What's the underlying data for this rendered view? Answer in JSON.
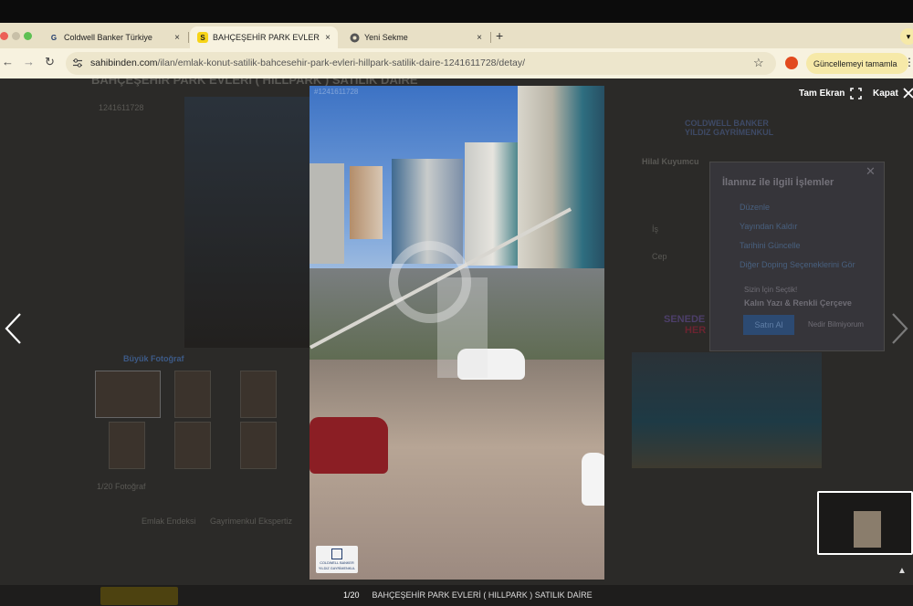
{
  "browser": {
    "tabs": [
      {
        "title": "Coldwell Banker Türkiye",
        "favicon": "cb-favicon-icon",
        "active": false
      },
      {
        "title": "BAHÇEŞEHİR PARK EVLERİ ( H",
        "favicon": "sahibinden-favicon-icon",
        "active": true
      },
      {
        "title": "Yeni Sekme",
        "favicon": "chrome-favicon-icon",
        "active": false
      }
    ],
    "url_domain": "sahibinden.com",
    "url_path": "/ilan/emlak-konut-satilik-bahcesehir-park-evleri-hillpark-satilik-daire-1241611728/detay/",
    "update_button": "Güncellemeyi tamamla",
    "new_tab_symbol": "+",
    "tab_close_symbol": "×"
  },
  "background_page": {
    "listing_title": "BAHÇEŞEHİR PARK EVLERİ ( HILLPARK ) SATILIK DAİRE",
    "listing_no": "1241611728",
    "big_photo_link": "Büyük Fotoğraf",
    "photo_count": "1/20 Fotoğraf",
    "links": [
      "Emlak Endeksi",
      "Gayrimenkul Ekspertiz"
    ],
    "agency": "COLDWELL BANKER YILDIZ GAYRİMENKUL",
    "seller": "Hilal Kuyumcu",
    "labels": [
      "İş",
      "Cep"
    ],
    "panel": {
      "title": "İlanınız ile ilgili İşlemler",
      "items": [
        "Düzenle",
        "Yayından Kaldır",
        "Tarihini Güncelle",
        "Diğer Doping Seçeneklerini Gör"
      ],
      "promo_label": "Sizin İçin Seçtik!",
      "promo_text": "Kalın Yazı & Renkli Çerçeve",
      "buy_button": "Satın Al",
      "info_link": "Nedir Bilmiyorum"
    },
    "banner": [
      "SENEDE",
      "HER"
    ]
  },
  "viewer": {
    "watermark_id": "#1241611728",
    "fullscreen_label": "Tam Ekran",
    "close_label": "Kapat",
    "counter": "1/20",
    "caption": "BAHÇEŞEHİR PARK EVLERİ ( HILLPARK ) SATILIK DAİRE",
    "logo_text": "COLDWELL BANKER",
    "logo_sub": "YILDIZ GAYRİMENKUL"
  }
}
